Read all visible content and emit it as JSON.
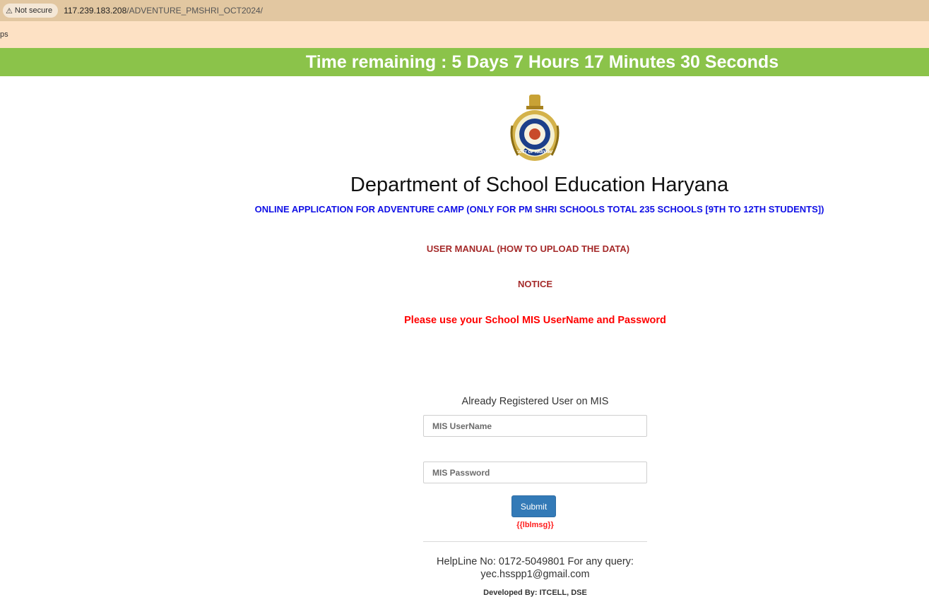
{
  "browser": {
    "security_label": "Not secure",
    "url_host": "117.239.183.208",
    "url_path": "/ADVENTURE_PMSHRI_OCT2024/",
    "bookmark_label": "ps"
  },
  "timer": {
    "text": "Time remaining : 5 Days 7 Hours 17 Minutes 30 Seconds"
  },
  "header": {
    "department_title": "Department of School Education Haryana",
    "subtitle": "ONLINE APPLICATION FOR ADVENTURE CAMP (ONLY FOR PM SHRI SCHOOLS TOTAL 235 SCHOOLS [9TH TO 12TH STUDENTS])",
    "emblem_icon": "haryana-govt-emblem-icon",
    "emblem_text": "GOVT OF HARYANA"
  },
  "links": {
    "user_manual": "USER MANUAL (HOW TO UPLOAD THE DATA)",
    "notice": "NOTICE"
  },
  "notes": {
    "mis_credentials": "Please use your School MIS UserName and Password"
  },
  "login": {
    "heading": "Already Registered User on MIS",
    "username_placeholder": "MIS UserName",
    "password_placeholder": "MIS Password",
    "submit_label": "Submit",
    "message": "{{lblmsg}}"
  },
  "footer": {
    "helpline": "HelpLine No: 0172-5049801 For any query: yec.hsspp1@gmail.com",
    "developed_by": "Developed By: ITCELL, DSE"
  },
  "colors": {
    "timer_bg": "#8bc34a",
    "subtitle": "#1010e6",
    "link": "#a52a2a",
    "warning": "#ff0000",
    "button": "#337ab7"
  }
}
